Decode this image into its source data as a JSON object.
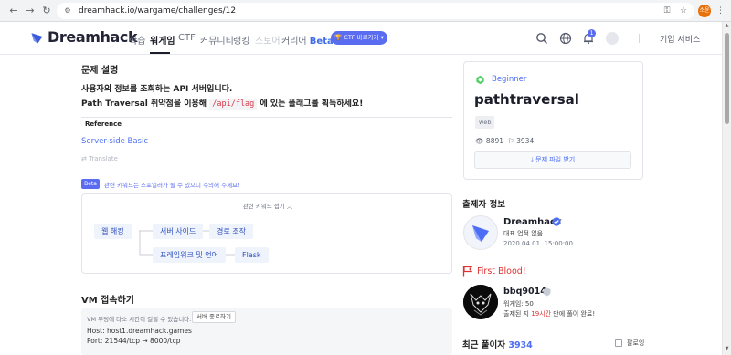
{
  "browser": {
    "url": "dreamhack.io/wargame/challenges/12",
    "back_icon": "arrow-left-icon",
    "forward_icon": "arrow-right-icon",
    "reload_icon": "reload-icon",
    "profile_initials": "소윤"
  },
  "header": {
    "brand": "Dreamhack",
    "nav": [
      "학습",
      "워게임",
      "CTF",
      "커뮤니티",
      "랭킹",
      "스토어",
      "커리어"
    ],
    "nav_beta": "Beta",
    "ctf_button": "CTF 바로가기",
    "notification_count": "1",
    "enterprise": "기업 서비스",
    "accent": "#5a6cf0"
  },
  "problem": {
    "section_title": "문제 설명",
    "desc_line1": "사용자의 정보를 조회하는 API 서버입니다.",
    "desc_line2_pre": "Path Traversal 취약점을 이용해",
    "desc_code": "/api/flag",
    "desc_line2_post": "에 있는 플래그를 획득하세요!",
    "reference_label": "Reference",
    "reference_link": "Server-side Basic",
    "translate": "Translate"
  },
  "keywords": {
    "beta": "Beta",
    "note": "관련 키워드는 스포일러가 될 수 있으니 주의해 주세요!",
    "title": "관련 키워드 접기",
    "nodes": [
      "웹 해킹",
      "서버 사이드",
      "경로 조작",
      "프레임워크 및 언어",
      "Flask"
    ]
  },
  "vm": {
    "title": "VM 접속하기",
    "note": "VM 부팅에 다소 시간이 걸릴 수 있습니다.",
    "stop_button": "서버 종료하기",
    "host": "Host: host1.dreamhack.games",
    "port": "Port:  21544/tcp → 8000/tcp"
  },
  "challenge": {
    "level": "Beginner",
    "title": "pathtraversal",
    "tag": "web",
    "views": "8891",
    "solves": "3934",
    "download_button": "문제 파일 받기"
  },
  "author": {
    "heading": "출제자 정보",
    "name": "Dreamhack",
    "subtitle": "대표 업적 없음",
    "date": "2020.04.01. 15:00:00"
  },
  "first_blood": {
    "heading": "First Blood!",
    "name": "bbq9014",
    "wargame_score": "워게임: 50",
    "time_pre": "출제된 지",
    "time_hl": "19시간",
    "time_post": "만에 풀이 완료!"
  },
  "recent": {
    "heading": "최근 풀이자",
    "count": "3934",
    "checkbox_label": "팔로잉"
  }
}
